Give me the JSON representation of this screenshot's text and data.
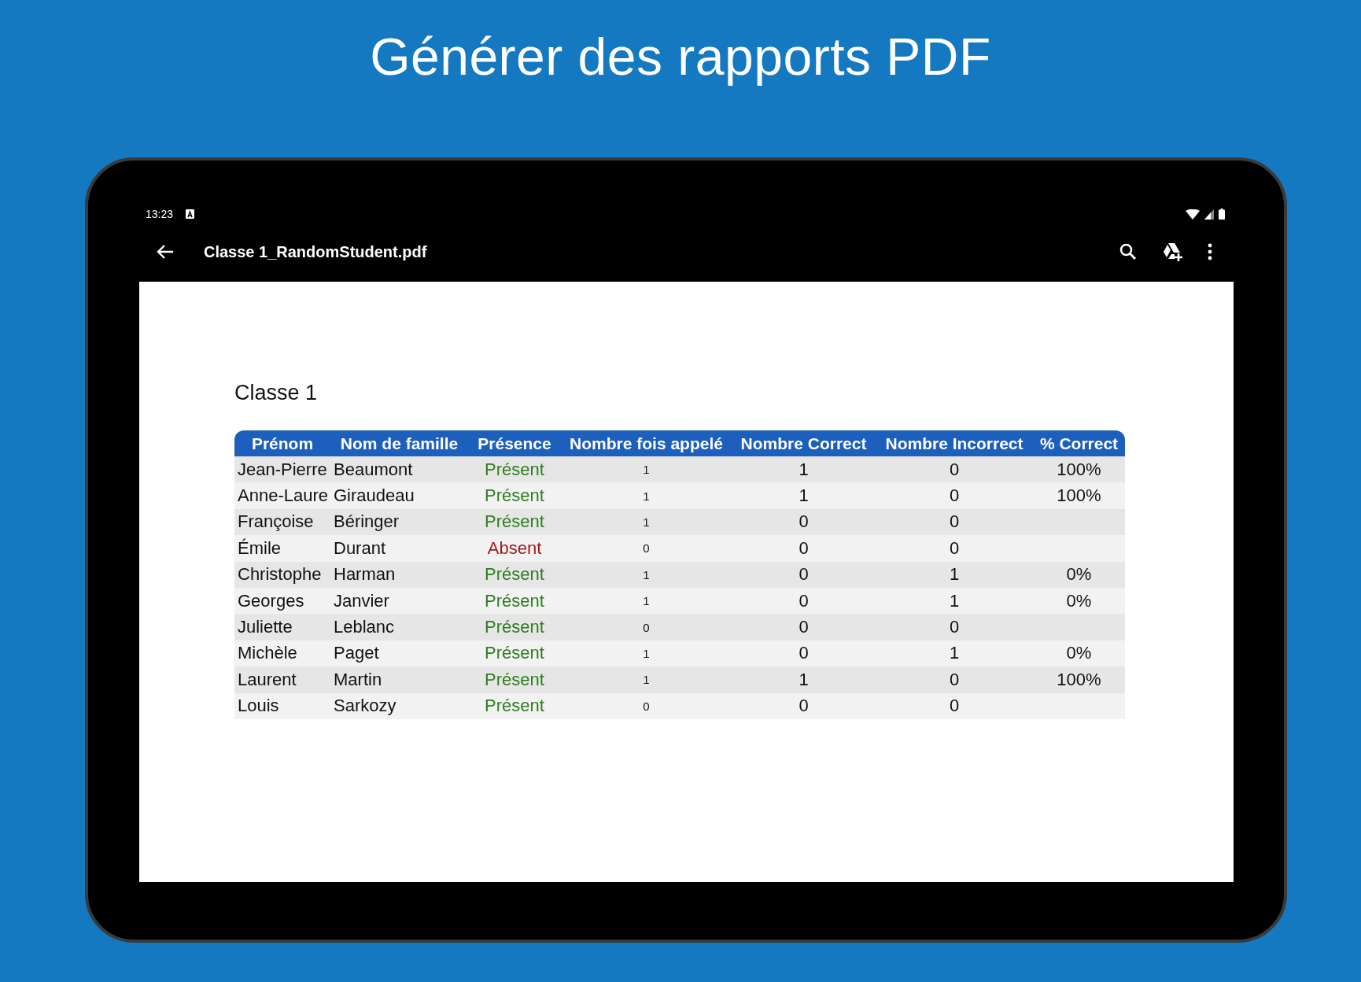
{
  "headline": "Générer des rapports PDF",
  "status_bar": {
    "time": "13:23"
  },
  "toolbar": {
    "title": "Classe 1_RandomStudent.pdf"
  },
  "document": {
    "title": "Classe 1",
    "table": {
      "columns": [
        "Prénom",
        "Nom de famille",
        "Présence",
        "Nombre fois appelé",
        "Nombre Correct",
        "Nombre Incorrect",
        "% Correct"
      ],
      "rows": [
        {
          "first": "Jean-Pierre",
          "last": "Beaumont",
          "presence": "Présent",
          "kind": "present",
          "called": "1",
          "correct": "1",
          "incorrect": "0",
          "percent": "100%"
        },
        {
          "first": "Anne-Laure",
          "last": "Giraudeau",
          "presence": "Présent",
          "kind": "present",
          "called": "1",
          "correct": "1",
          "incorrect": "0",
          "percent": "100%"
        },
        {
          "first": "Françoise",
          "last": "Béringer",
          "presence": "Présent",
          "kind": "present",
          "called": "1",
          "correct": "0",
          "incorrect": "0"
        },
        {
          "first": "Émile",
          "last": "Durant",
          "presence": "Absent",
          "kind": "absent",
          "called": "0",
          "correct": "0",
          "incorrect": "0"
        },
        {
          "first": "Christophe",
          "last": "Harman",
          "presence": "Présent",
          "kind": "present",
          "called": "1",
          "correct": "0",
          "incorrect": "1",
          "percent": "0%"
        },
        {
          "first": "Georges",
          "last": "Janvier",
          "presence": "Présent",
          "kind": "present",
          "called": "1",
          "correct": "0",
          "incorrect": "1",
          "percent": "0%"
        },
        {
          "first": "Juliette",
          "last": "Leblanc",
          "presence": "Présent",
          "kind": "present",
          "called": "0",
          "correct": "0",
          "incorrect": "0"
        },
        {
          "first": "Michèle",
          "last": "Paget",
          "presence": "Présent",
          "kind": "present",
          "called": "1",
          "correct": "0",
          "incorrect": "1",
          "percent": "0%"
        },
        {
          "first": "Laurent",
          "last": "Martin",
          "presence": "Présent",
          "kind": "present",
          "called": "1",
          "correct": "1",
          "incorrect": "0",
          "percent": "100%"
        },
        {
          "first": "Louis",
          "last": "Sarkozy",
          "presence": "Présent",
          "kind": "present",
          "called": "0",
          "correct": "0",
          "incorrect": "0"
        }
      ]
    }
  }
}
